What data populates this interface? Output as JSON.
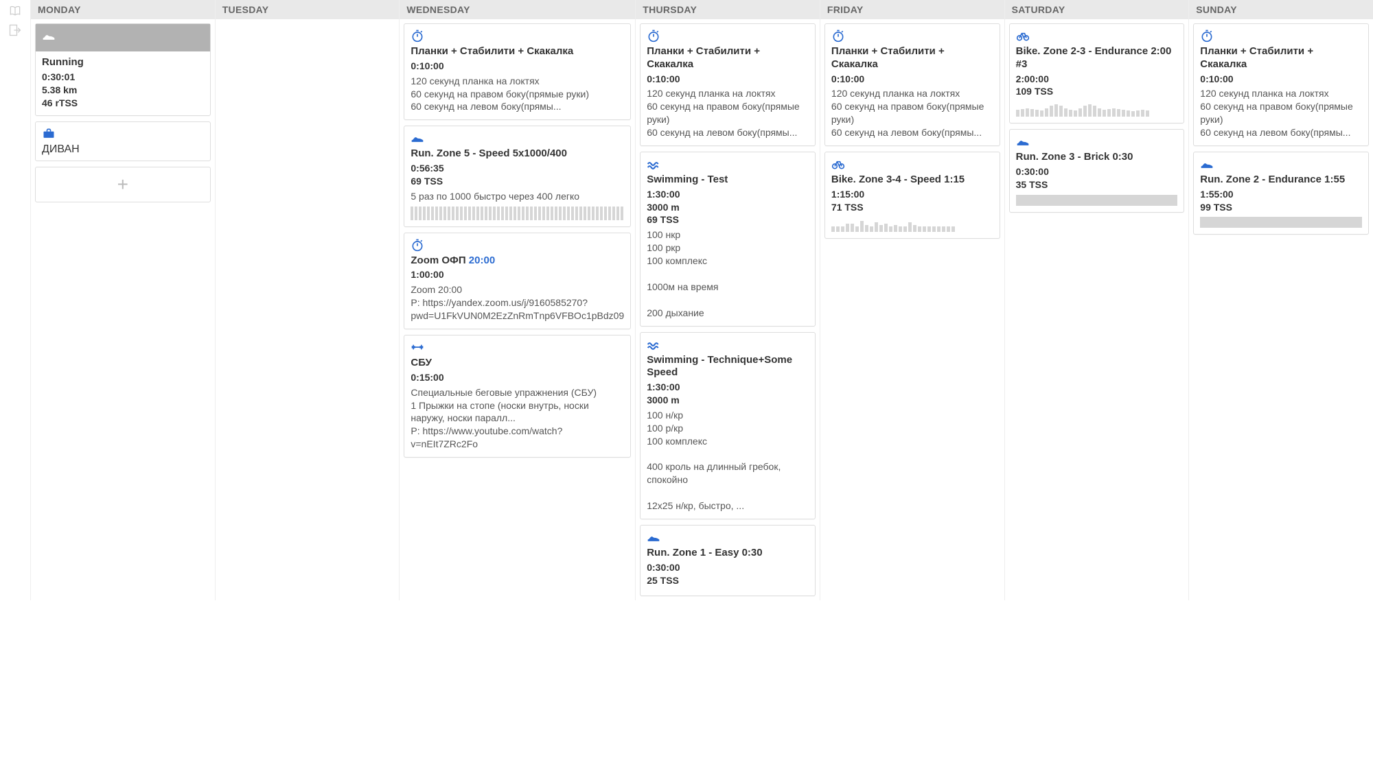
{
  "colors": {
    "accent": "#2b6bd1",
    "completed_bg": "#b2b2b2",
    "header_bg": "#e9e9e9",
    "text_muted": "#666"
  },
  "leftbar": [
    "book-open-icon",
    "exit-icon"
  ],
  "days": [
    {
      "key": "monday",
      "label": "MONDAY",
      "cards": [
        {
          "id": "mon-run",
          "kind": "completed",
          "icon": "shoe-icon",
          "title": "Running",
          "metrics": [
            "0:30:01",
            "5.38 km",
            "46 rTSS"
          ]
        },
        {
          "id": "mon-couch",
          "kind": "event",
          "icon": "briefcase-icon",
          "title": "ДИВАН"
        }
      ],
      "show_add": true
    },
    {
      "key": "tuesday",
      "label": "TUESDAY",
      "cards": [],
      "show_add": false
    },
    {
      "key": "wednesday",
      "label": "WEDNESDAY",
      "cards": [
        {
          "id": "wed-plank",
          "kind": "planned",
          "icon": "stopwatch-icon",
          "title": "Планки + Стабилити + Скакалка",
          "metrics": [
            "0:10:00"
          ],
          "desc": "120 секунд планка на локтях\n60 секунд на правом боку(прямые руки)\n60 секунд на левом боку(прямы..."
        },
        {
          "id": "wed-run",
          "kind": "planned",
          "icon": "shoe-icon",
          "title": "Run. Zone 5 - Speed 5x1000/400",
          "metrics": [
            "0:56:35",
            "69 TSS"
          ],
          "desc": "5 раз по 1000 быстро через 400 легко",
          "spark": "flat"
        },
        {
          "id": "wed-zoom",
          "kind": "planned",
          "icon": "stopwatch-icon",
          "title_html": [
            "Zoom ОФП ",
            "20:00"
          ],
          "metrics": [
            "1:00:00"
          ],
          "desc": "Zoom 20:00\nP: https://yandex.zoom.us/j/9160585270?pwd=U1FkVUN0M2EzZnRmTnp6VFBOc1pBdz09"
        },
        {
          "id": "wed-sbu",
          "kind": "planned",
          "icon": "dumbbell-icon",
          "title": "СБУ",
          "metrics": [
            "0:15:00"
          ],
          "desc": "Специальные беговые упражнения (СБУ)\n1 Прыжки на стопе (носки внутрь, носки наружу, носки паралл...\nP: https://www.youtube.com/watch?v=nEIt7ZRc2Fo"
        }
      ],
      "show_add": false
    },
    {
      "key": "thursday",
      "label": "THURSDAY",
      "cards": [
        {
          "id": "thu-plank",
          "kind": "planned",
          "icon": "stopwatch-icon",
          "title": "Планки + Стабилити + Скакалка",
          "metrics": [
            "0:10:00"
          ],
          "desc": "120 секунд планка на локтях\n60 секунд на правом боку(прямые руки)\n60 секунд на левом боку(прямы..."
        },
        {
          "id": "thu-swim-test",
          "kind": "planned",
          "icon": "wave-icon",
          "title": "Swimming - Test",
          "metrics": [
            "1:30:00",
            "3000 m",
            "69 TSS"
          ],
          "desc": "100 нкр\n100 ркр\n100 комплекс\n\n1000м на время\n\n200 дыхание"
        },
        {
          "id": "thu-swim-tech",
          "kind": "planned",
          "icon": "wave-icon",
          "title": "Swimming - Technique+Some Speed",
          "metrics": [
            "1:30:00",
            "3000 m"
          ],
          "desc": "100 н/кр\n100 р/кр\n100 комплекс\n\n400 кроль на длинный гребок, спокойно\n\n12х25 н/кр, быстро, ..."
        },
        {
          "id": "thu-run-easy",
          "kind": "planned",
          "icon": "shoe-icon",
          "title": "Run. Zone 1 - Easy 0:30",
          "metrics": [
            "0:30:00",
            "25 TSS"
          ]
        }
      ],
      "show_add": false
    },
    {
      "key": "friday",
      "label": "FRIDAY",
      "cards": [
        {
          "id": "fri-plank",
          "kind": "planned",
          "icon": "stopwatch-icon",
          "title": "Планки + Стабилити + Скакалка",
          "metrics": [
            "0:10:00"
          ],
          "desc": "120 секунд планка на локтях\n60 секунд на правом боку(прямые руки)\n60 секунд на левом боку(прямы..."
        },
        {
          "id": "fri-bike",
          "kind": "planned",
          "icon": "bike-icon",
          "title": "Bike. Zone 3-4 - Speed 1:15",
          "metrics": [
            "1:15:00",
            "71 TSS"
          ],
          "spark": "varied"
        }
      ],
      "show_add": false
    },
    {
      "key": "saturday",
      "label": "SATURDAY",
      "cards": [
        {
          "id": "sat-bike",
          "kind": "planned",
          "icon": "bike-icon",
          "title": "Bike. Zone 2-3 - Endurance 2:00 #3",
          "metrics": [
            "2:00:00",
            "109 TSS"
          ],
          "spark": "waves"
        },
        {
          "id": "sat-run",
          "kind": "planned",
          "icon": "shoe-icon",
          "title": "Run. Zone 3 - Brick 0:30",
          "metrics": [
            "0:30:00",
            "35 TSS"
          ],
          "spark": "flat-full"
        }
      ],
      "show_add": false
    },
    {
      "key": "sunday",
      "label": "SUNDAY",
      "cards": [
        {
          "id": "sun-plank",
          "kind": "planned",
          "icon": "stopwatch-icon",
          "title": "Планки + Стабилити + Скакалка",
          "metrics": [
            "0:10:00"
          ],
          "desc": "120 секунд планка на локтях\n60 секунд на правом боку(прямые руки)\n60 секунд на левом боку(прямы..."
        },
        {
          "id": "sun-run",
          "kind": "planned",
          "icon": "shoe-icon",
          "title": "Run. Zone 2 - Endurance 1:55",
          "metrics": [
            "1:55:00",
            "99 TSS"
          ],
          "spark": "flat-full"
        }
      ],
      "show_add": false
    }
  ]
}
